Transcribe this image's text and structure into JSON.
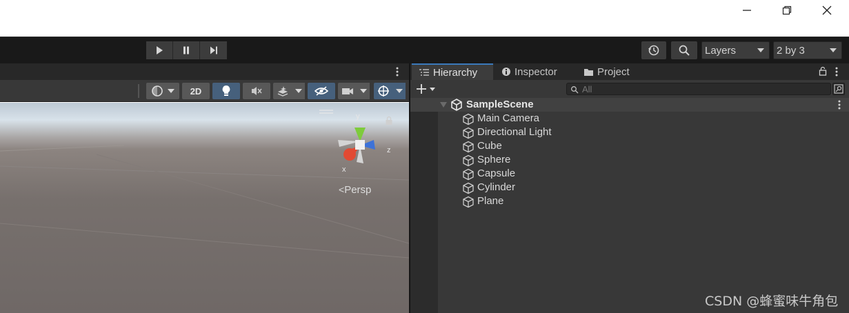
{
  "window_controls": {
    "minimize_icon": "minimize-icon",
    "restore_icon": "restore-icon",
    "close_icon": "close-icon"
  },
  "toolbar": {
    "play_icon": "play-icon",
    "pause_icon": "pause-icon",
    "step_icon": "step-icon",
    "history_icon": "history-icon",
    "search_icon": "search-icon",
    "layers_label": "Layers",
    "layout_label": "2 by 3"
  },
  "scene": {
    "toolbar": {
      "shading_icon": "shading-mode-icon",
      "mode_2d_label": "2D",
      "lighting_icon": "lightbulb-icon",
      "audio_icon": "audio-mute-icon",
      "effects_icon": "effects-icon",
      "hidden_icon": "hidden-eye-icon",
      "camera_icon": "camera-icon",
      "gizmos_icon": "gizmos-icon"
    },
    "gizmo": {
      "y_label": "y",
      "z_label": "z",
      "x_label": "x"
    },
    "projection_label": "Persp"
  },
  "hierarchy": {
    "tabs": [
      {
        "label": "Hierarchy",
        "icon": "hierarchy-list-icon",
        "active": true
      },
      {
        "label": "Inspector",
        "icon": "info-icon",
        "active": false
      },
      {
        "label": "Project",
        "icon": "folder-icon",
        "active": false
      }
    ],
    "search_placeholder": "All",
    "scene_name": "SampleScene",
    "objects": [
      "Main Camera",
      "Directional Light",
      "Cube",
      "Sphere",
      "Capsule",
      "Cylinder",
      "Plane"
    ]
  },
  "watermark": "CSDN @蜂蜜味牛角包",
  "colors": {
    "accent_blue": "#3a79bb",
    "active_button": "#46607c",
    "panel_bg": "#383838",
    "toolbar_bg": "#191919"
  }
}
